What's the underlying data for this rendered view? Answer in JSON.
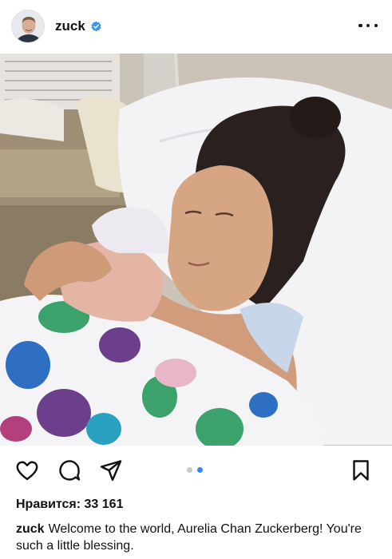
{
  "post": {
    "username": "zuck",
    "verified": true,
    "image_alt": "Newborn baby resting on mother's chest in a hospital bed",
    "carousel": {
      "count": 2,
      "active_index": 1
    }
  },
  "icons": {
    "like": "heart-icon",
    "comment": "comment-icon",
    "share": "paper-plane-icon",
    "save": "bookmark-icon",
    "more": "more-options-icon",
    "verified": "verified-badge-icon"
  },
  "stats": {
    "likes_text": "Нравится: 33 161"
  },
  "caption": {
    "username": "zuck",
    "text": "Welcome to the world, Aurelia Chan Zuckerberg! You're such a little blessing."
  },
  "colors": {
    "verified_blue": "#3897f0",
    "carousel_active": "#2e8cf0",
    "carousel_inactive": "#c8c8c8"
  }
}
